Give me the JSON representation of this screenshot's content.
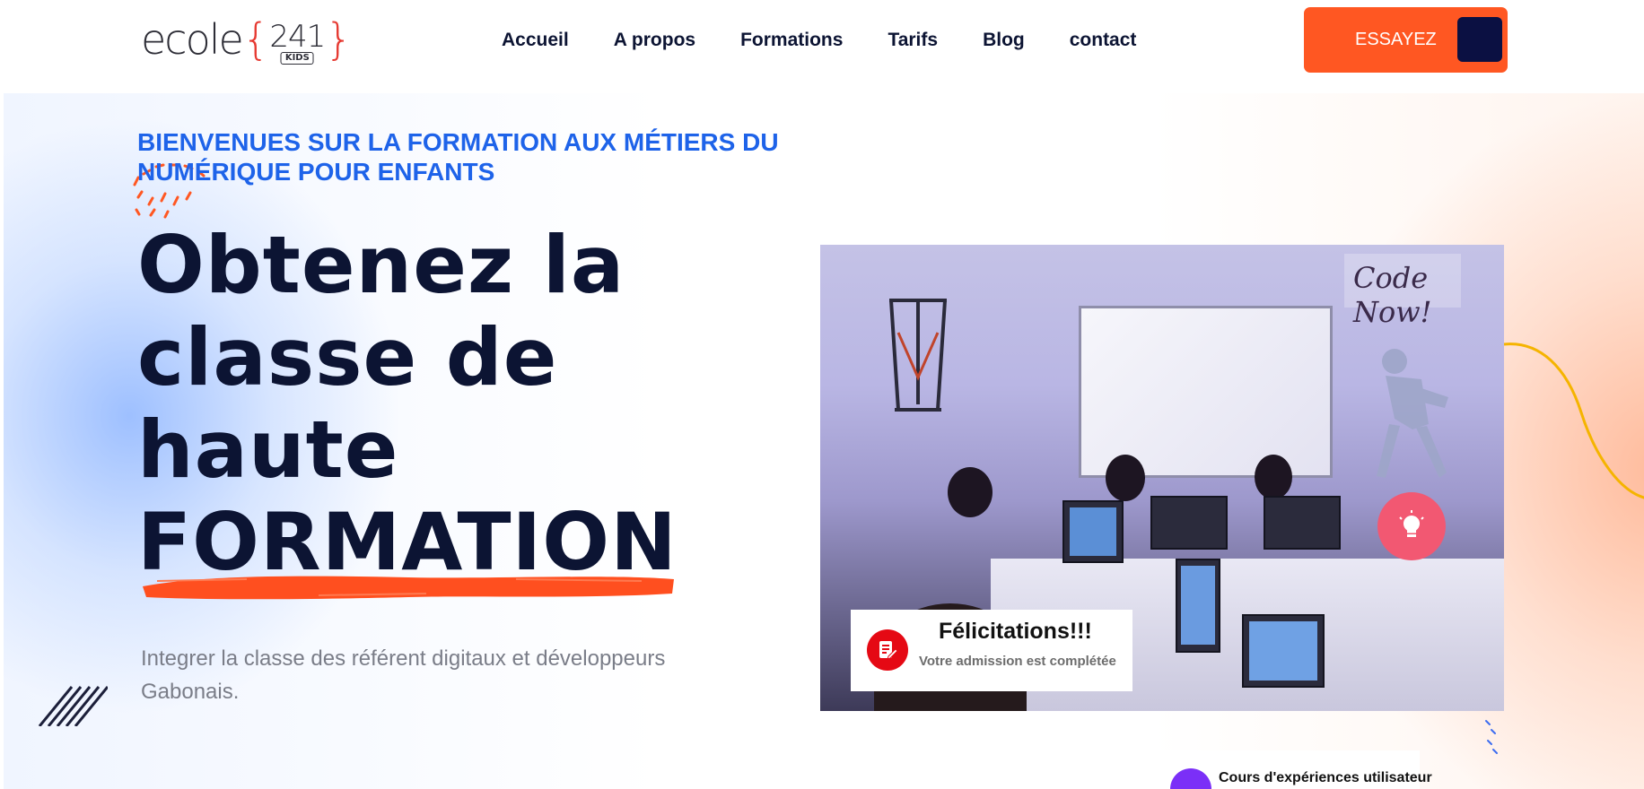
{
  "header": {
    "logo": {
      "word": "ecole",
      "brace_open": "{",
      "number": "241",
      "brace_close": "}",
      "badge": "KIDS"
    },
    "nav": [
      {
        "label": "Accueil"
      },
      {
        "label": "A propos"
      },
      {
        "label": "Formations"
      },
      {
        "label": "Tarifs"
      },
      {
        "label": "Blog"
      },
      {
        "label": "contact"
      }
    ],
    "cta_label": "ESSAYEZ"
  },
  "hero": {
    "tagline": "BIENVENUES SUR LA FORMATION AUX MÉTIERS DU NUMÉRIQUE POUR ENFANTS",
    "headline_lines": [
      "Obtenez la",
      "classe de",
      "haute",
      "FORMATION"
    ],
    "description": "Integrer la classe des référent digitaux et développeurs Gabonais."
  },
  "photo": {
    "sign_text": "Code Now!"
  },
  "cards": {
    "admission_title": "Félicitations!!!",
    "admission_subtitle": "Votre admission est complétée",
    "course_title": "Cours d'expériences utilisateur"
  },
  "colors": {
    "accent_orange": "#ff5722",
    "navy": "#0c1433",
    "link_blue": "#1e63e9",
    "card_red": "#e50914",
    "card_purple": "#7b2ff7",
    "bulb_pink": "#f25872"
  }
}
